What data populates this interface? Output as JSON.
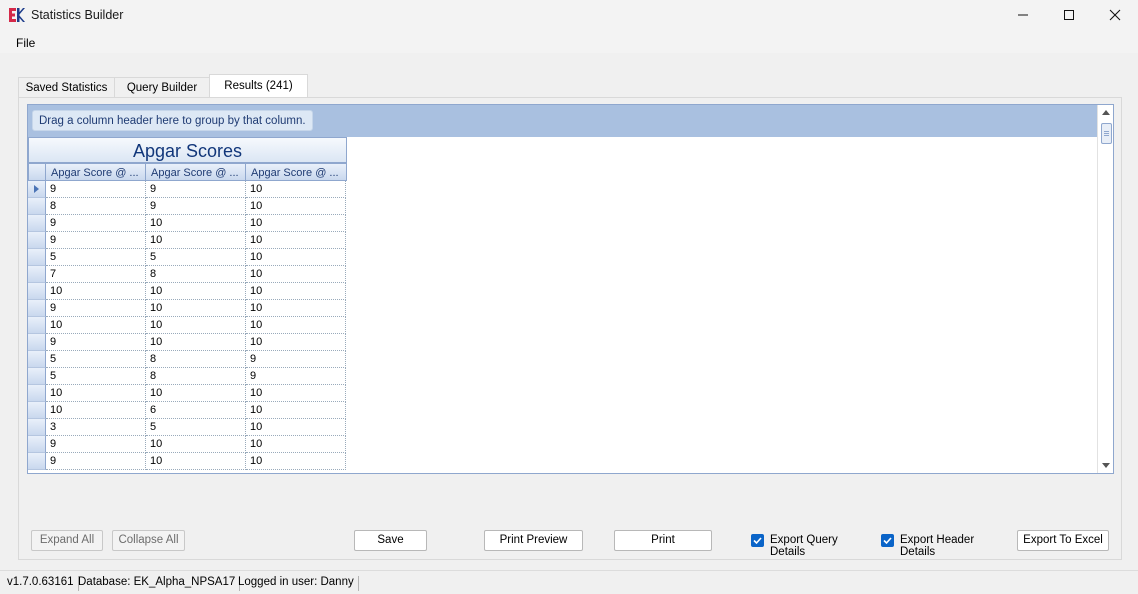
{
  "window": {
    "title": "Statistics Builder",
    "app_icon": "ek-logo-icon",
    "controls": [
      "minimize-icon",
      "maximize-icon",
      "close-icon"
    ]
  },
  "menu": {
    "file": "File"
  },
  "tabs": [
    {
      "label": "Saved Statistics",
      "active": false
    },
    {
      "label": "Query Builder",
      "active": false
    },
    {
      "label": "Results (241)",
      "active": true
    }
  ],
  "grid": {
    "group_hint": "Drag a column header here to group by that column.",
    "band_title": "Apgar Scores",
    "columns": [
      "Apgar Score @ ...",
      "Apgar Score @ ...",
      "Apgar Score @ ..."
    ],
    "rows": [
      [
        "9",
        "9",
        "10"
      ],
      [
        "8",
        "9",
        "10"
      ],
      [
        "9",
        "10",
        "10"
      ],
      [
        "9",
        "10",
        "10"
      ],
      [
        "5",
        "5",
        "10"
      ],
      [
        "7",
        "8",
        "10"
      ],
      [
        "10",
        "10",
        "10"
      ],
      [
        "9",
        "10",
        "10"
      ],
      [
        "10",
        "10",
        "10"
      ],
      [
        "9",
        "10",
        "10"
      ],
      [
        "5",
        "8",
        "9"
      ],
      [
        "5",
        "8",
        "9"
      ],
      [
        "10",
        "10",
        "10"
      ],
      [
        "10",
        "6",
        "10"
      ],
      [
        "3",
        "5",
        "10"
      ],
      [
        "9",
        "10",
        "10"
      ],
      [
        "9",
        "10",
        "10"
      ]
    ]
  },
  "actions": {
    "expand_all": "Expand All",
    "collapse_all": "Collapse All",
    "save": "Save",
    "print_preview": "Print Preview",
    "print": "Print",
    "export_query_details": "Export Query Details",
    "export_header_details": "Export Header Details",
    "export_to_excel": "Export To Excel"
  },
  "checkboxes": {
    "export_query_details": true,
    "export_header_details": true
  },
  "status": {
    "version": "v1.7.0.63161",
    "database": "Database: EK_Alpha_NPSA17",
    "user": "Logged in user: Danny"
  },
  "colors": {
    "accent": "#0a64c8",
    "grid_header": "#a9c0e0",
    "band_text": "#11367a"
  }
}
